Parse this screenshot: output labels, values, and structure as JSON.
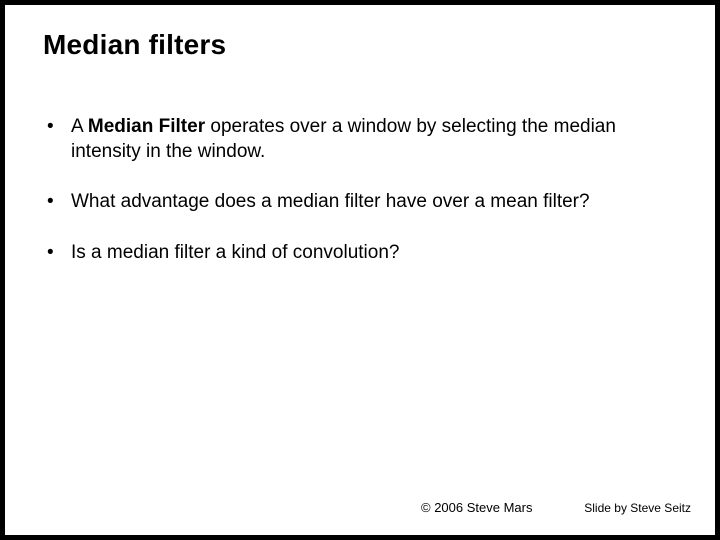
{
  "title": "Median filters",
  "bullets": [
    {
      "prefix": "A ",
      "bold": "Median Filter",
      "rest": " operates over a window by selecting the median intensity in the window."
    },
    {
      "prefix": "What advantage does a median filter have over a mean filter?",
      "bold": "",
      "rest": ""
    },
    {
      "prefix": "Is a median filter a kind of convolution?",
      "bold": "",
      "rest": ""
    }
  ],
  "footer_left": "© 2006 Steve Mars",
  "footer_right": "Slide by Steve Seitz"
}
